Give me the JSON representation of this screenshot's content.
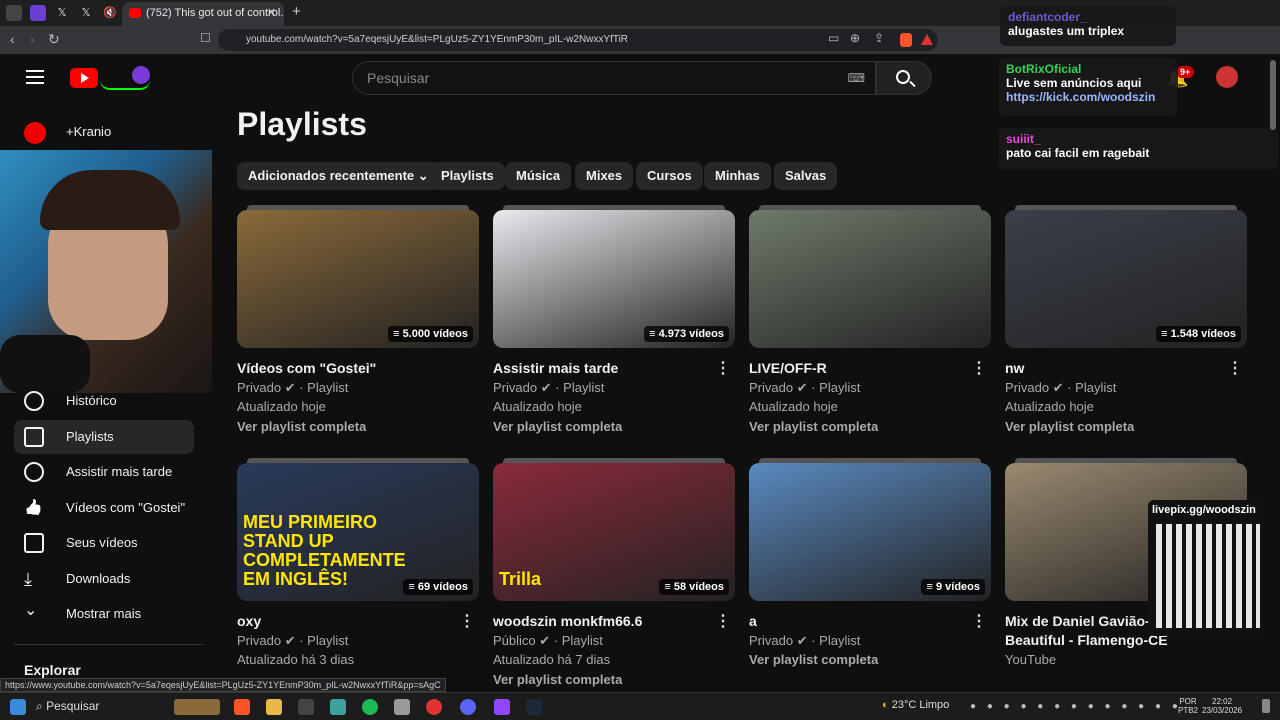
{
  "browser": {
    "active_tab_title": "(752) This got out of control. - Y",
    "url": "youtube.com/watch?v=5a7eqesjUyE&list=PLgUz5-ZY1YEnmP30m_pIL-w2NwxxYfTiR",
    "status_url": "https://www.youtube.com/watch?v=5a7eqesjUyE&list=PLgUz5-ZY1YEnmP30m_pIL-w2NwxxYfTiR&pp=sAgC"
  },
  "youtube": {
    "search_placeholder": "Pesquisar",
    "notif_count": "9+",
    "sidebar_top_item": "+Kranio",
    "sidebar": [
      {
        "label": "Histórico",
        "icon": "history-icon"
      },
      {
        "label": "Playlists",
        "icon": "playlists-icon",
        "active": true
      },
      {
        "label": "Assistir mais tarde",
        "icon": "clock-icon"
      },
      {
        "label": "Vídeos com \"Gostei\"",
        "icon": "like-icon"
      },
      {
        "label": "Seus vídeos",
        "icon": "video-icon"
      },
      {
        "label": "Downloads",
        "icon": "download-icon"
      },
      {
        "label": "Mostrar mais",
        "icon": "chevron-down-icon"
      }
    ],
    "explore_heading": "Explorar",
    "page_title": "Playlists",
    "chips": [
      "Adicionados recentemente",
      "Playlists",
      "Música",
      "Mixes",
      "Cursos",
      "Minhas",
      "Salvas"
    ],
    "playlists": [
      {
        "title": "Vídeos com \"Gostei\"",
        "count": "5.000 vídeos",
        "privacy": "Privado",
        "type": "Playlist",
        "updated": "Atualizado hoje",
        "link": "Ver playlist completa",
        "color": "#8a6a3a"
      },
      {
        "title": "Assistir mais tarde",
        "count": "4.973 vídeos",
        "privacy": "Privado",
        "type": "Playlist",
        "updated": "Atualizado hoje",
        "link": "Ver playlist completa",
        "color": "#e9e9ee"
      },
      {
        "title": "LIVE/OFF-R",
        "count": "",
        "privacy": "Privado",
        "type": "Playlist",
        "updated": "Atualizado hoje",
        "link": "Ver playlist completa",
        "color": "#6e7a6a"
      },
      {
        "title": "nw",
        "count": "1.548 vídeos",
        "privacy": "Privado",
        "type": "Playlist",
        "updated": "Atualizado hoje",
        "link": "Ver playlist completa",
        "color": "#3a3f4a"
      },
      {
        "title": "oxy",
        "count": "69 vídeos",
        "privacy": "Privado",
        "type": "Playlist",
        "updated": "Atualizado há 3 dias",
        "link": "",
        "color": "#2a3a5a",
        "overlay_text": "MEU PRIMEIRO STAND UP COMPLETAMENTE EM INGLÊS!"
      },
      {
        "title": "woodszin monkfm66.6",
        "count": "58 vídeos",
        "privacy": "Público",
        "type": "Playlist",
        "updated": "Atualizado há 7 dias",
        "link": "Ver playlist completa",
        "color": "#8a2a3a",
        "overlay_text": "Trilla"
      },
      {
        "title": "a",
        "count": "9 vídeos",
        "privacy": "Privado",
        "type": "Playlist",
        "updated": "",
        "link": "Ver playlist completa",
        "color": "#5a8ac0"
      },
      {
        "title": "Mix de Daniel Gavião-Y",
        "title2": "Beautiful - Flamengo-CE",
        "count": "",
        "privacy": "YouTube",
        "type": "",
        "updated": "",
        "link": "",
        "color": "#9a8a70"
      }
    ]
  },
  "stream_overlay": {
    "chat": [
      {
        "user": "defiantcoder_",
        "text": "alugastes um triplex"
      },
      {
        "user": "BotRixOficial",
        "text": "Live sem anúncios aqui",
        "link": "https://kick.com/woodszin"
      },
      {
        "user": "suiiit_",
        "text": "pato cai facil em ragebait"
      }
    ],
    "qr_label": "livepix.gg/woodszin"
  },
  "taskbar": {
    "search_placeholder": "Pesquisar",
    "weather": "23°C  Limpo",
    "lang": "POR",
    "lang2": "PTB2",
    "time": "22:02",
    "date": "23/03/2026"
  }
}
